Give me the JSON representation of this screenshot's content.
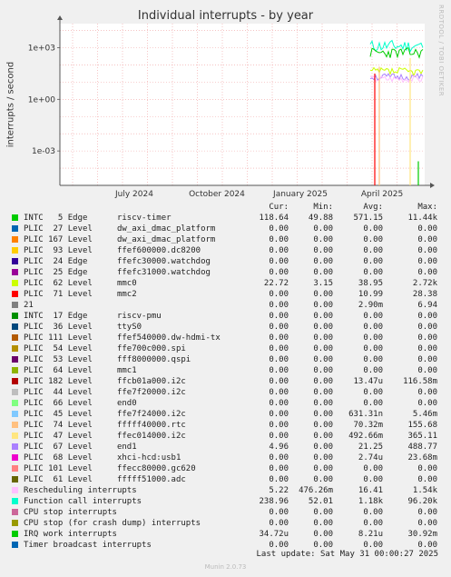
{
  "chart_data": {
    "type": "line",
    "title": "Individual interrupts - by year",
    "ylabel": "interrupts / second",
    "yscale": "log",
    "y_ticks": [
      "1e+03",
      "1e+00",
      "1e-03"
    ],
    "x_ticks": [
      "July 2024",
      "October 2024",
      "January 2025",
      "April 2025"
    ],
    "grid": true,
    "side_label": "RRDTOOL / TOBI OETIKER",
    "columns": [
      "Cur:",
      "Min:",
      "Avg:",
      "Max:"
    ],
    "series": [
      {
        "label": "INTC   5 Edge      riscv-timer",
        "color": "#00cc00",
        "cur": "118.64",
        "min": "49.88",
        "avg": "571.15",
        "max": "11.44k"
      },
      {
        "label": "PLIC  27 Level     dw_axi_dmac_platform",
        "color": "#0066b3",
        "cur": "0.00",
        "min": "0.00",
        "avg": "0.00",
        "max": "0.00"
      },
      {
        "label": "PLIC 167 Level     dw_axi_dmac_platform",
        "color": "#ff8000",
        "cur": "0.00",
        "min": "0.00",
        "avg": "0.00",
        "max": "0.00"
      },
      {
        "label": "PLIC  93 Level     ffef600000.dc8200",
        "color": "#ffcc00",
        "cur": "0.00",
        "min": "0.00",
        "avg": "0.00",
        "max": "0.00"
      },
      {
        "label": "PLIC  24 Edge      ffefc30000.watchdog",
        "color": "#330099",
        "cur": "0.00",
        "min": "0.00",
        "avg": "0.00",
        "max": "0.00"
      },
      {
        "label": "PLIC  25 Edge      ffefc31000.watchdog",
        "color": "#990099",
        "cur": "0.00",
        "min": "0.00",
        "avg": "0.00",
        "max": "0.00"
      },
      {
        "label": "PLIC  62 Level     mmc0",
        "color": "#ccff00",
        "cur": "22.72",
        "min": "3.15",
        "avg": "38.95",
        "max": "2.72k"
      },
      {
        "label": "PLIC  71 Level     mmc2",
        "color": "#ff0000",
        "cur": "0.00",
        "min": "0.00",
        "avg": "10.99",
        "max": "28.38"
      },
      {
        "label": "21",
        "color": "#808080",
        "cur": "0.00",
        "min": "0.00",
        "avg": "2.90m",
        "max": "6.94"
      },
      {
        "label": "INTC  17 Edge      riscv-pmu",
        "color": "#008f00",
        "cur": "0.00",
        "min": "0.00",
        "avg": "0.00",
        "max": "0.00"
      },
      {
        "label": "PLIC  36 Level     ttyS0",
        "color": "#00487d",
        "cur": "0.00",
        "min": "0.00",
        "avg": "0.00",
        "max": "0.00"
      },
      {
        "label": "PLIC 111 Level     ffef540000.dw-hdmi-tx",
        "color": "#b35a00",
        "cur": "0.00",
        "min": "0.00",
        "avg": "0.00",
        "max": "0.00"
      },
      {
        "label": "PLIC  54 Level     ffe700c000.spi",
        "color": "#b38f00",
        "cur": "0.00",
        "min": "0.00",
        "avg": "0.00",
        "max": "0.00"
      },
      {
        "label": "PLIC  53 Level     fff8000000.qspi",
        "color": "#6b006b",
        "cur": "0.00",
        "min": "0.00",
        "avg": "0.00",
        "max": "0.00"
      },
      {
        "label": "PLIC  64 Level     mmc1",
        "color": "#8fb300",
        "cur": "0.00",
        "min": "0.00",
        "avg": "0.00",
        "max": "0.00"
      },
      {
        "label": "PLIC 182 Level     ffcb01a000.i2c",
        "color": "#b30000",
        "cur": "0.00",
        "min": "0.00",
        "avg": "13.47u",
        "max": "116.58m"
      },
      {
        "label": "PLIC  44 Level     ffe7f20000.i2c",
        "color": "#bebebe",
        "cur": "0.00",
        "min": "0.00",
        "avg": "0.00",
        "max": "0.00"
      },
      {
        "label": "PLIC  66 Level     end0",
        "color": "#80ff80",
        "cur": "0.00",
        "min": "0.00",
        "avg": "0.00",
        "max": "0.00"
      },
      {
        "label": "PLIC  45 Level     ffe7f24000.i2c",
        "color": "#80c9ff",
        "cur": "0.00",
        "min": "0.00",
        "avg": "631.31n",
        "max": "5.46m"
      },
      {
        "label": "PLIC  74 Level     fffff40000.rtc",
        "color": "#ffc080",
        "cur": "0.00",
        "min": "0.00",
        "avg": "70.32m",
        "max": "155.68"
      },
      {
        "label": "PLIC  47 Level     ffec014000.i2c",
        "color": "#ffe680",
        "cur": "0.00",
        "min": "0.00",
        "avg": "492.66m",
        "max": "365.11"
      },
      {
        "label": "PLIC  67 Level     end1",
        "color": "#aa80ff",
        "cur": "4.96",
        "min": "0.00",
        "avg": "21.25",
        "max": "488.77"
      },
      {
        "label": "PLIC  68 Level     xhci-hcd:usb1",
        "color": "#ee00cc",
        "cur": "0.00",
        "min": "0.00",
        "avg": "2.74u",
        "max": "23.68m"
      },
      {
        "label": "PLIC 101 Level     ffecc80000.gc620",
        "color": "#ff8080",
        "cur": "0.00",
        "min": "0.00",
        "avg": "0.00",
        "max": "0.00"
      },
      {
        "label": "PLIC  61 Level     fffff51000.adc",
        "color": "#666600",
        "cur": "0.00",
        "min": "0.00",
        "avg": "0.00",
        "max": "0.00"
      },
      {
        "label": "Rescheduling interrupts",
        "color": "#ffbfff",
        "cur": "5.22",
        "min": "476.26m",
        "avg": "16.41",
        "max": "1.54k"
      },
      {
        "label": "Function call interrupts",
        "color": "#00ffcc",
        "cur": "238.96",
        "min": "52.01",
        "avg": "1.18k",
        "max": "96.20k"
      },
      {
        "label": "CPU stop interrupts",
        "color": "#cc6699",
        "cur": "0.00",
        "min": "0.00",
        "avg": "0.00",
        "max": "0.00"
      },
      {
        "label": "CPU stop (for crash dump) interrupts",
        "color": "#999900",
        "cur": "0.00",
        "min": "0.00",
        "avg": "0.00",
        "max": "0.00"
      },
      {
        "label": "IRQ work interrupts",
        "color": "#00cc00",
        "cur": "34.72u",
        "min": "0.00",
        "avg": "8.21u",
        "max": "30.92m"
      },
      {
        "label": "Timer broadcast interrupts",
        "color": "#0066b3",
        "cur": "0.00",
        "min": "0.00",
        "avg": "0.00",
        "max": "0.00"
      }
    ],
    "last_update": "Last update: Sat May 31 00:00:27 2025",
    "footer": "Munin 2.0.73"
  }
}
